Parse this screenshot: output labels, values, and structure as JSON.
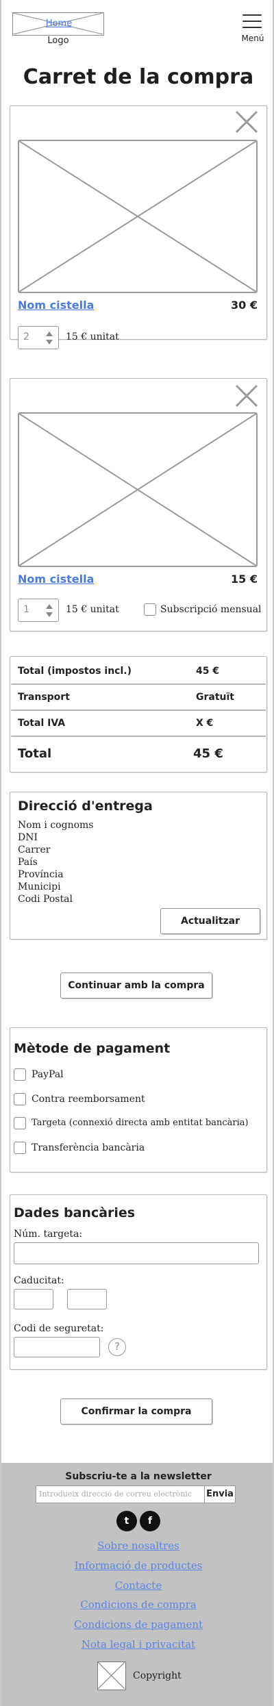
{
  "header": {
    "logo_home": "Home",
    "logo_label": "Logo",
    "menu_label": "Menú"
  },
  "page_title": "Carret de la compra",
  "cart_items": [
    {
      "name": "Nom cistella",
      "price": "30 €",
      "quantity": "2",
      "unit_price": "15 € unitat"
    },
    {
      "name": "Nom cistella",
      "price": "15 €",
      "quantity": "1",
      "unit_price": "15 € unitat",
      "subscription_label": "Subscripció mensual"
    }
  ],
  "totals": {
    "rows": [
      {
        "label": "Total (impostos incl.)",
        "value": "45 €"
      },
      {
        "label": "Transport",
        "value": "Gratuït"
      },
      {
        "label": "Total IVA",
        "value": "X €"
      }
    ],
    "grand_label": "Total",
    "grand_value": "45 €"
  },
  "address": {
    "title": "Direcció d'entrega",
    "lines": [
      "Nom i cognoms",
      "DNI",
      "Carrer",
      "País",
      "Província",
      "Municipi",
      "Codi Postal"
    ],
    "update_button": "Actualitzar"
  },
  "continue_button": "Continuar amb la compra",
  "payment": {
    "title": "Mètode de pagament",
    "options": [
      "PayPal",
      "Contra reemborsament",
      "Targeta (connexió directa amb entitat bancària)",
      "Transferència bancària"
    ]
  },
  "bank": {
    "title": "Dades bancàries",
    "card_label": "Núm. targeta:",
    "expiry_label": "Caducitat:",
    "cvv_label": "Codi de seguretat:",
    "help_glyph": "?"
  },
  "confirm_button": "Confirmar la compra",
  "footer": {
    "newsletter_title": "Subscriu-te a la newsletter",
    "newsletter_placeholder": "Introdueix direcció de correu electrònic",
    "newsletter_button": "Envia",
    "social": [
      "twitter",
      "facebook"
    ],
    "social_glyphs": [
      "t",
      "f"
    ],
    "links": [
      "Sobre nosaltres",
      "Informació de productes",
      "Contacte",
      "Condicions de compra",
      "Condicions de pagament",
      "Nota legal i privacitat"
    ],
    "copyright": "Copyright"
  }
}
